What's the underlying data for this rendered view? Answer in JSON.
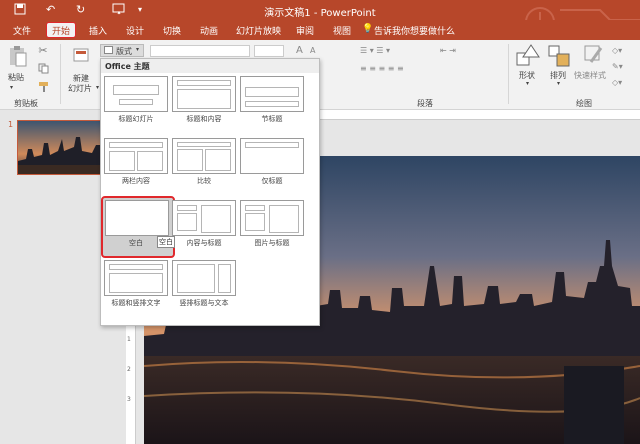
{
  "window": {
    "title": "演示文稿1 - PowerPoint"
  },
  "tabs": [
    "文件",
    "开始",
    "插入",
    "设计",
    "切换",
    "动画",
    "幻灯片放映",
    "审阅",
    "视图"
  ],
  "tell_me": "告诉我你想要做什么",
  "ribbon": {
    "paste": "粘贴",
    "clipboard_group": "剪贴板",
    "new_slide_line1": "新建",
    "new_slide_line2": "幻灯片",
    "layout_button": "版式",
    "paragraph_group": "段落",
    "shape": "形状",
    "arrange": "排列",
    "quick_styles": "快速样式",
    "drawing_group": "绘图"
  },
  "slides_panel": {
    "slide_number": "1"
  },
  "layout_menu": {
    "header": "Office 主题",
    "layouts": [
      "标题幻灯片",
      "标题和内容",
      "节标题",
      "两栏内容",
      "比较",
      "仅标题",
      "空白",
      "内容与标题",
      "图片与标题",
      "标题和竖排文字",
      "竖排标题与文本"
    ],
    "tooltip": "空白",
    "selected": "空白"
  },
  "ruler": {
    "v_ticks": [
      "1",
      "2",
      "3"
    ]
  },
  "colors": {
    "accent": "#b7472a",
    "highlight": "#e0282c"
  }
}
